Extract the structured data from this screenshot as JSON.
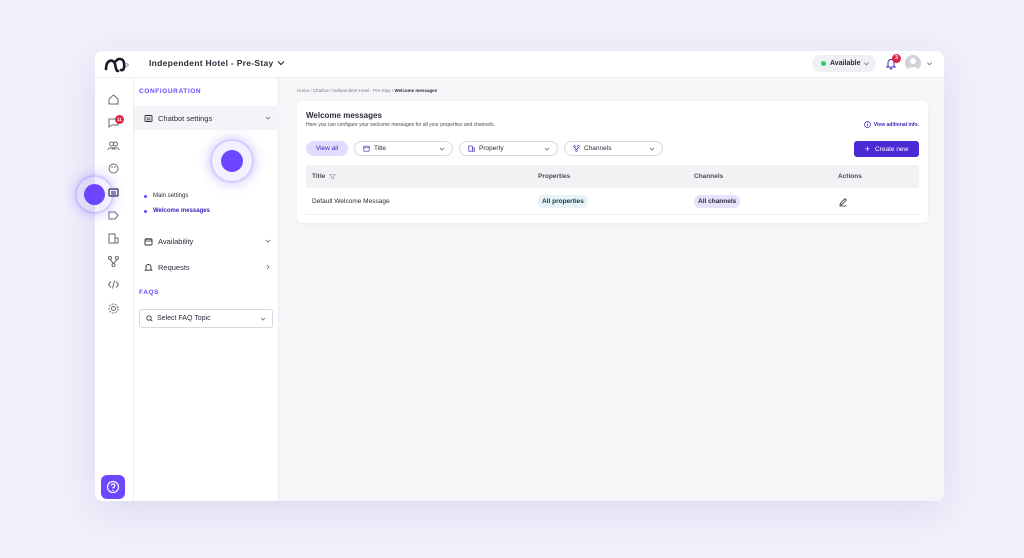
{
  "header": {
    "hotel_title": "Independent Hotel - Pre-Stay",
    "status_label": "Available",
    "notification_count": "3"
  },
  "rail": {
    "chat_badge": "11"
  },
  "config": {
    "section_label": "CONFIGURATION",
    "items": [
      {
        "label": "Chatbot settings"
      },
      {
        "label": "Availability"
      },
      {
        "label": "Requests"
      }
    ],
    "sub_items": [
      {
        "label": "Main settings"
      },
      {
        "label": "Welcome messages"
      }
    ],
    "faqs_label": "FAQS",
    "faq_select_placeholder": "Select FAQ Topic"
  },
  "breadcrumb": {
    "items": [
      "Home",
      "Chatbot",
      "Independent Hotel - Pre-Stay"
    ],
    "current": "Welcome messages",
    "separator": "/"
  },
  "card": {
    "title": "Welcome messages",
    "subtitle": "Here you can configure your welcome messages for all your properties and channels.",
    "info_link": "View aditional info.",
    "filters": {
      "view_all": "View all",
      "title": "Title",
      "property": "Property",
      "channels": "Channels"
    },
    "create_button": "Create new",
    "table": {
      "headers": {
        "title": "Title",
        "properties": "Properties",
        "channels": "Channels",
        "actions": "Actions"
      },
      "rows": [
        {
          "title": "Default Welcome Message",
          "properties": "All properties",
          "channels": "All channels"
        }
      ]
    }
  },
  "colors": {
    "accent": "#6c47ff",
    "primary_button": "#4b2bd1",
    "badge": "#e0244a",
    "status_online": "#2ecc71"
  }
}
